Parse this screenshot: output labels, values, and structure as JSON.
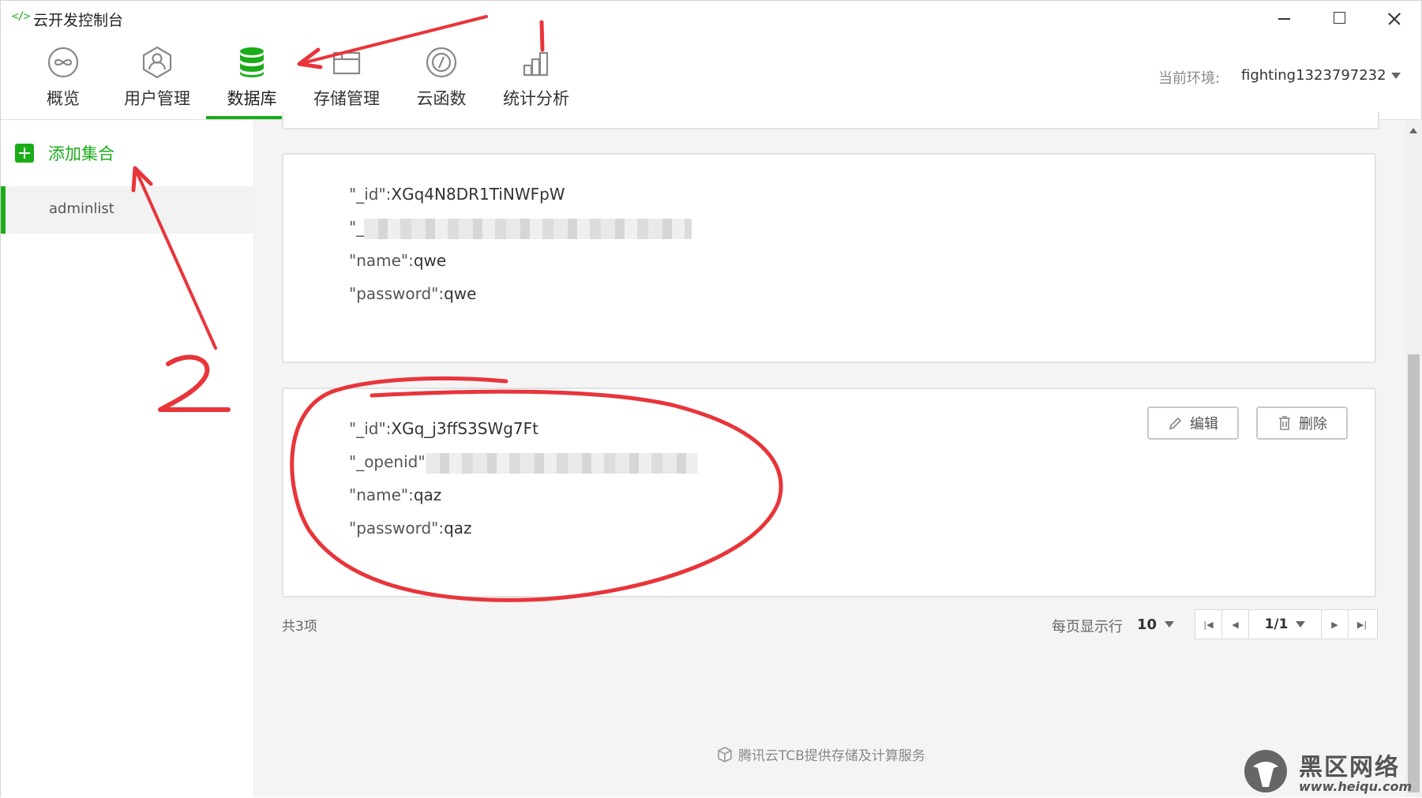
{
  "window": {
    "logo": "</>",
    "title": "云开发控制台"
  },
  "nav": {
    "tabs": [
      {
        "label": "概览",
        "icon": "infinity-icon"
      },
      {
        "label": "用户管理",
        "icon": "user-hexagon-icon"
      },
      {
        "label": "数据库",
        "icon": "database-icon",
        "active": true
      },
      {
        "label": "存储管理",
        "icon": "storage-folder-icon"
      },
      {
        "label": "云函数",
        "icon": "cloud-function-icon"
      },
      {
        "label": "统计分析",
        "icon": "bar-chart-icon"
      }
    ],
    "env_label": "当前环境:",
    "env_value": "fighting1323797232"
  },
  "sidebar": {
    "add_collection_label": "添加集合",
    "collections": [
      {
        "label": "adminlist",
        "active": true
      }
    ]
  },
  "records": [
    {
      "id_key": "\"_id\":",
      "id_value": "XGq4N8DR1TiNWFpW",
      "openid_key": "\"_",
      "openid_value": "",
      "name_key": "\"name\":",
      "name_value": "qwe",
      "password_key": "\"password\":",
      "password_value": "qwe"
    },
    {
      "id_key": "\"_id\":",
      "id_value": "XGq_j3ffS3SWg7Ft",
      "openid_key": "\"_openid\"",
      "openid_value": "",
      "name_key": "\"name\":",
      "name_value": "qaz",
      "password_key": "\"password\":",
      "password_value": "qaz"
    }
  ],
  "actions": {
    "edit_label": "编辑",
    "delete_label": "删除"
  },
  "footer": {
    "total": "共3项",
    "rows_per_page_label": "每页显示行",
    "rows_per_page": "10",
    "page": "1/1",
    "credit": "腾讯云TCB提供存储及计算服务"
  },
  "annotations": {
    "color": "#e8353a",
    "label_1": "1",
    "label_2": "2"
  },
  "watermark": {
    "title": "黑区网络",
    "url": "www.heiqu.com"
  },
  "colors": {
    "accent": "#1aad19",
    "annotation": "#e8353a",
    "background": "#f4f4f4"
  }
}
